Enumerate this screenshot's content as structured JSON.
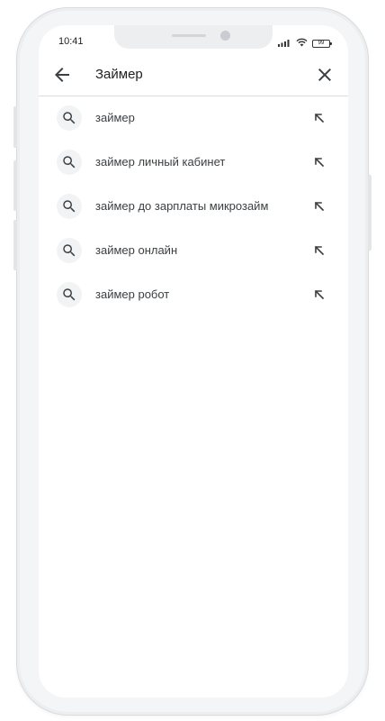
{
  "status_bar": {
    "time": "10:41",
    "battery": "99",
    "icons": [
      "signal-icon",
      "wifi-icon",
      "battery-icon"
    ]
  },
  "search": {
    "query": "Займер",
    "back_icon": "arrow-left-icon",
    "clear_icon": "close-icon"
  },
  "suggestions": [
    {
      "text": "займер",
      "icon": "search-icon",
      "action_icon": "arrow-up-left-icon"
    },
    {
      "text": "займер личный кабинет",
      "icon": "search-icon",
      "action_icon": "arrow-up-left-icon"
    },
    {
      "text": "займер до зарплаты микрозайм",
      "icon": "search-icon",
      "action_icon": "arrow-up-left-icon"
    },
    {
      "text": "займер онлайн",
      "icon": "search-icon",
      "action_icon": "arrow-up-left-icon"
    },
    {
      "text": "займер робот",
      "icon": "search-icon",
      "action_icon": "arrow-up-left-icon"
    }
  ],
  "colors": {
    "frame": "#eceef0",
    "text_primary": "#202124",
    "text_suggestion": "#3c4043",
    "icon_bg": "#f1f3f4",
    "divider": "#dcdcdc"
  }
}
